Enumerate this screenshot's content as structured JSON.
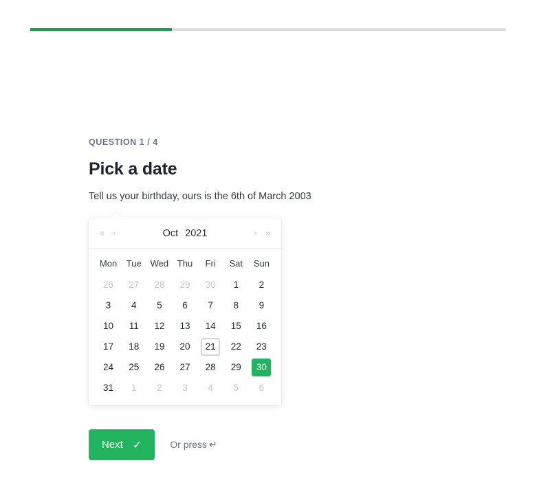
{
  "progress": {
    "percent": 29.8,
    "fill_color": "#17a44e",
    "track_color": "#dcdfe2"
  },
  "form": {
    "question_counter": "QUESTION 1 / 4",
    "title": "Pick a date",
    "description": "Tell us your birthday, ours is the 6th of March 2003"
  },
  "calendar": {
    "nav": {
      "prev_year": "«",
      "prev_month": "‹",
      "next_month": "›",
      "next_year": "»"
    },
    "month": "Oct",
    "year": "2021",
    "weekdays": [
      "Mon",
      "Tue",
      "Wed",
      "Thu",
      "Fri",
      "Sat",
      "Sun"
    ],
    "today": 21,
    "selected": 30,
    "accent_selected_color": "#1fb45e",
    "today_border_color": "#d8cdf4",
    "weeks": [
      [
        {
          "label": "26",
          "muted": true
        },
        {
          "label": "27",
          "muted": true
        },
        {
          "label": "28",
          "muted": true
        },
        {
          "label": "29",
          "muted": true
        },
        {
          "label": "30",
          "muted": true
        },
        {
          "label": "1",
          "muted": false
        },
        {
          "label": "2",
          "muted": false
        }
      ],
      [
        {
          "label": "3",
          "muted": false
        },
        {
          "label": "4",
          "muted": false
        },
        {
          "label": "5",
          "muted": false
        },
        {
          "label": "6",
          "muted": false
        },
        {
          "label": "7",
          "muted": false
        },
        {
          "label": "8",
          "muted": false
        },
        {
          "label": "9",
          "muted": false
        }
      ],
      [
        {
          "label": "10",
          "muted": false
        },
        {
          "label": "11",
          "muted": false
        },
        {
          "label": "12",
          "muted": false
        },
        {
          "label": "13",
          "muted": false
        },
        {
          "label": "14",
          "muted": false
        },
        {
          "label": "15",
          "muted": false
        },
        {
          "label": "16",
          "muted": false
        }
      ],
      [
        {
          "label": "17",
          "muted": false
        },
        {
          "label": "18",
          "muted": false
        },
        {
          "label": "19",
          "muted": false
        },
        {
          "label": "20",
          "muted": false
        },
        {
          "label": "21",
          "muted": false,
          "state": "today"
        },
        {
          "label": "22",
          "muted": false
        },
        {
          "label": "23",
          "muted": false
        }
      ],
      [
        {
          "label": "24",
          "muted": false
        },
        {
          "label": "25",
          "muted": false
        },
        {
          "label": "26",
          "muted": false
        },
        {
          "label": "27",
          "muted": false
        },
        {
          "label": "28",
          "muted": false
        },
        {
          "label": "29",
          "muted": false
        },
        {
          "label": "30",
          "muted": false,
          "state": "selected"
        }
      ],
      [
        {
          "label": "31",
          "muted": false
        },
        {
          "label": "1",
          "muted": true
        },
        {
          "label": "2",
          "muted": true
        },
        {
          "label": "3",
          "muted": true
        },
        {
          "label": "4",
          "muted": true
        },
        {
          "label": "5",
          "muted": true
        },
        {
          "label": "6",
          "muted": true
        }
      ]
    ]
  },
  "footer": {
    "next_label": "Next",
    "check_glyph": "✓",
    "hint_text": "Or press",
    "enter_glyph": "↵",
    "button_color": "#21b35d"
  }
}
